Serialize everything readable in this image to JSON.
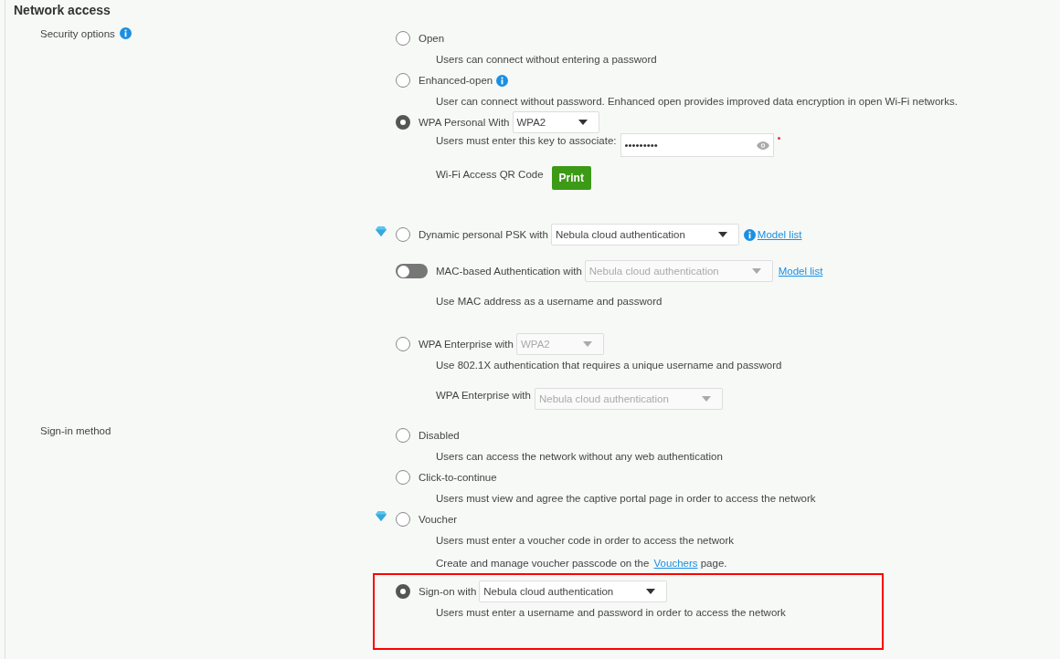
{
  "title": "Network access",
  "sections": [
    {
      "label": "Security options",
      "info": true,
      "options": [
        {
          "kind": "radio",
          "label": "Open",
          "selected": false,
          "description": "Users can connect without entering a password"
        },
        {
          "kind": "radio",
          "label": "Enhanced-open",
          "selected": false,
          "info": true,
          "description": "User can connect without password. Enhanced open provides improved data encryption in open Wi-Fi networks."
        },
        {
          "kind": "radio",
          "label": "WPA Personal With",
          "selected": true,
          "dropdown": {
            "value": "WPA2",
            "disabled": false
          },
          "key_field": {
            "label": "Users must enter this key to associate:",
            "value": "•••••••••",
            "required": true
          },
          "qr": {
            "label": "Wi-Fi Access QR Code",
            "button": "Print"
          }
        },
        {
          "kind": "radio",
          "label": "Dynamic personal PSK with",
          "selected": false,
          "premium": true,
          "dropdown": {
            "value": "Nebula cloud authentication",
            "disabled": false
          },
          "info": true,
          "link": "Model list"
        },
        {
          "kind": "toggle",
          "label": "MAC-based Authentication with",
          "on": false,
          "dropdown": {
            "value": "Nebula cloud authentication",
            "disabled": true
          },
          "link": "Model list",
          "description": "Use MAC address as a username and password"
        },
        {
          "kind": "radio",
          "label": "WPA Enterprise with",
          "selected": false,
          "dropdown": {
            "value": "WPA2",
            "disabled": true
          },
          "description": "Use 802.1X authentication that requires a unique username and password",
          "sub_dropdown": {
            "label": "WPA Enterprise with",
            "value": "Nebula cloud authentication",
            "disabled": true
          }
        }
      ]
    },
    {
      "label": "Sign-in method",
      "info": false,
      "options": [
        {
          "kind": "radio",
          "label": "Disabled",
          "selected": false,
          "description": "Users can access the network without any web authentication"
        },
        {
          "kind": "radio",
          "label": "Click-to-continue",
          "selected": false,
          "description": "Users must view and agree the captive portal page in order to access the network"
        },
        {
          "kind": "radio",
          "label": "Voucher",
          "selected": false,
          "premium": true,
          "description": "Users must enter a voucher code in order to access the network",
          "note": {
            "before": "Create and manage voucher passcode on the",
            "link": "Vouchers",
            "after": "page."
          }
        },
        {
          "kind": "radio",
          "label": "Sign-on with",
          "selected": true,
          "highlight": true,
          "dropdown": {
            "value": "Nebula cloud authentication",
            "disabled": false
          },
          "description": "Users must enter a username and password in order to access the network"
        }
      ]
    }
  ]
}
